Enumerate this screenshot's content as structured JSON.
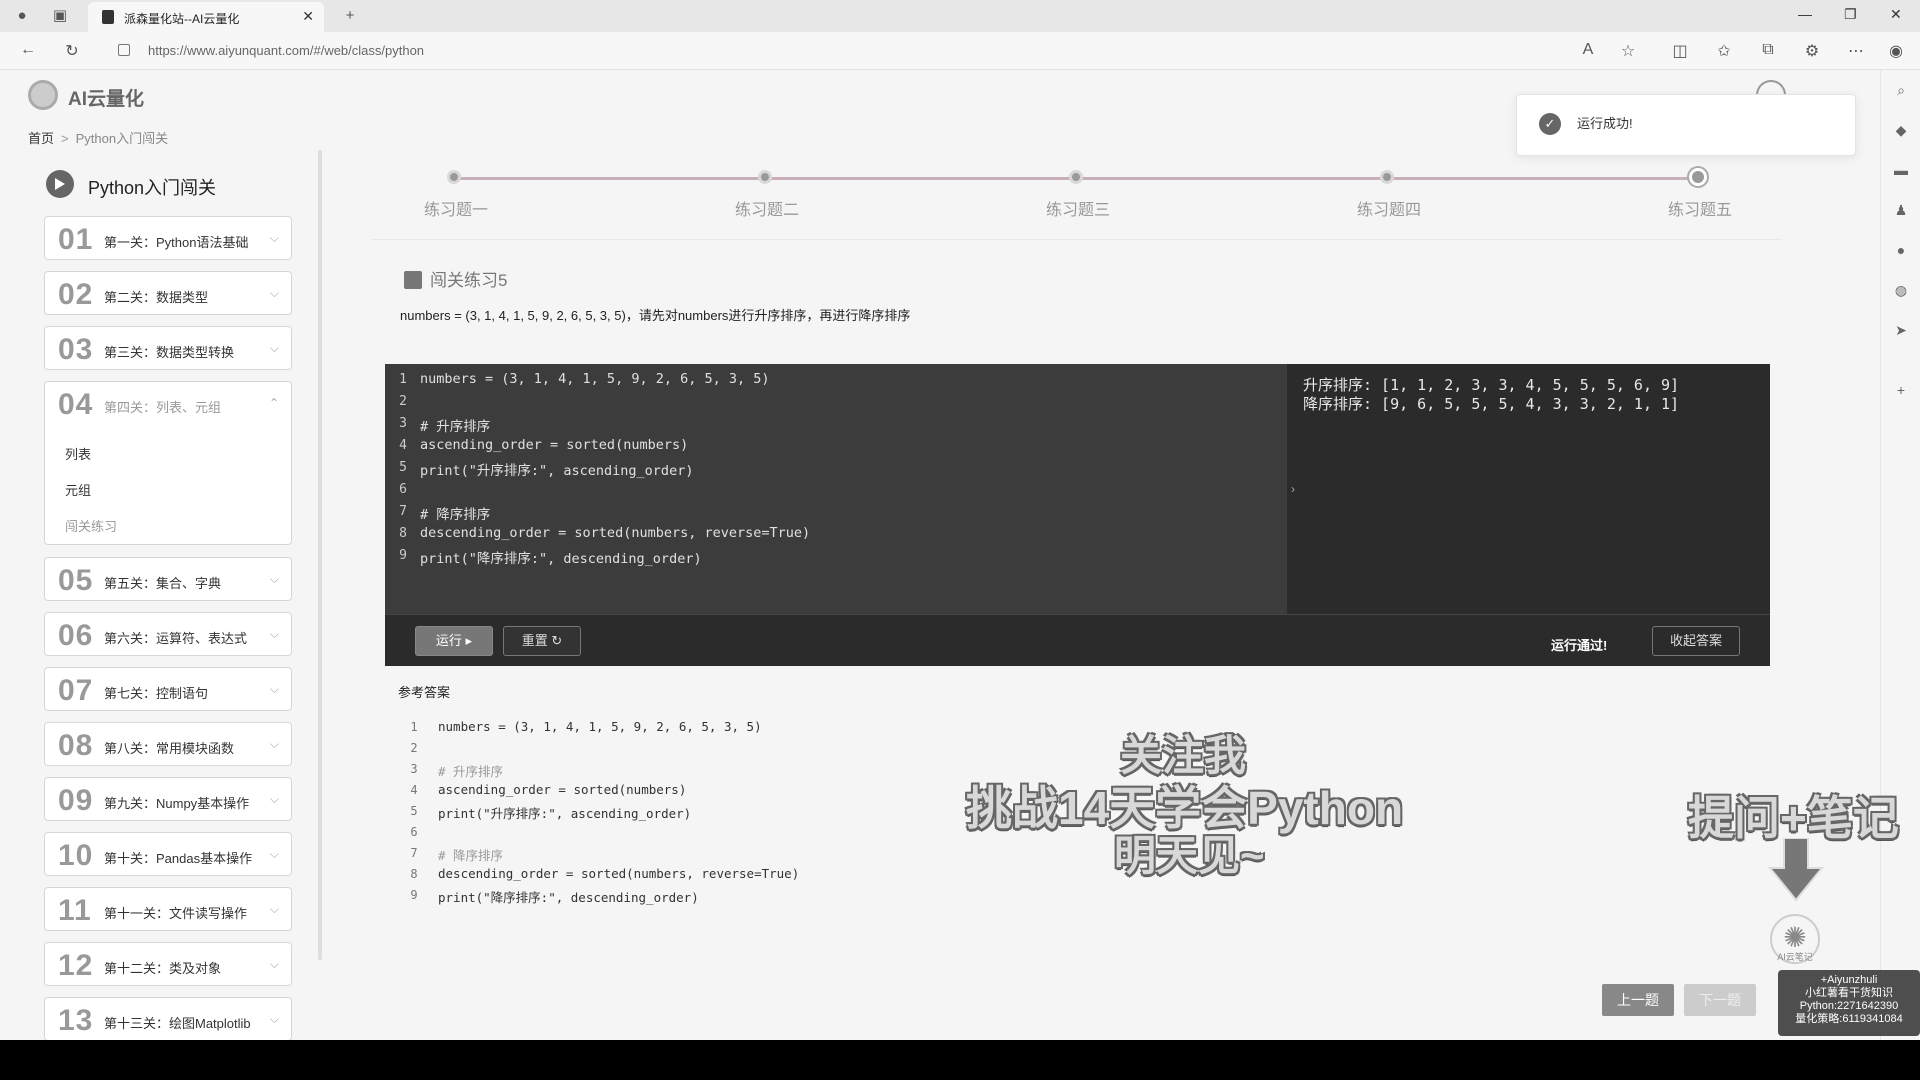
{
  "browser": {
    "tab_title": "派森量化站--AI云量化",
    "url": "https://www.aiyunquant.com/#/web/class/python"
  },
  "site": {
    "brand": "AI云量化",
    "breadcrumb": {
      "home": "首页",
      "current": "Python入门闯关"
    }
  },
  "sidebar": {
    "title": "Python入门闯关",
    "levels": [
      {
        "num": "01",
        "name": "第一关：Python语法基础",
        "chevron": "⌵"
      },
      {
        "num": "02",
        "name": "第二关：数据类型",
        "chevron": "⌵"
      },
      {
        "num": "03",
        "name": "第三关：数据类型转换",
        "chevron": "⌵"
      },
      {
        "num": "04",
        "name": "第四关：列表、元组",
        "chevron": "⌃"
      },
      {
        "num": "05",
        "name": "第五关：集合、字典",
        "chevron": "⌵"
      },
      {
        "num": "06",
        "name": "第六关：运算符、表达式",
        "chevron": "⌵"
      },
      {
        "num": "07",
        "name": "第七关：控制语句",
        "chevron": "⌵"
      },
      {
        "num": "08",
        "name": "第八关：常用模块函数",
        "chevron": "⌵"
      },
      {
        "num": "09",
        "name": "第九关：Numpy基本操作",
        "chevron": "⌵"
      },
      {
        "num": "10",
        "name": "第十关：Pandas基本操作",
        "chevron": "⌵"
      },
      {
        "num": "11",
        "name": "第十一关：文件读写操作",
        "chevron": "⌵"
      },
      {
        "num": "12",
        "name": "第十二关：类及对象",
        "chevron": "⌵"
      },
      {
        "num": "13",
        "name": "第十三关：绘图Matplotlib",
        "chevron": "⌵"
      }
    ],
    "level4_subitems": [
      "列表",
      "元组",
      "闯关练习"
    ]
  },
  "stepper": {
    "steps": [
      "练习题一",
      "练习题二",
      "练习题三",
      "练习题四",
      "练习题五"
    ],
    "current_step_index": 4
  },
  "toast": {
    "message": "运行成功!"
  },
  "exercise": {
    "title": "闯关练习5",
    "description": "numbers = (3, 1, 4, 1, 5, 9, 2, 6, 5, 3, 5)，请先对numbers进行升序排序，再进行降序排序"
  },
  "editor": {
    "lines": [
      "numbers = (3, 1, 4, 1, 5, 9, 2, 6, 5, 3, 5)",
      "",
      "# 升序排序",
      "ascending_order = sorted(numbers)",
      "print(\"升序排序:\", ascending_order)",
      "",
      "# 降序排序",
      "descending_order = sorted(numbers, reverse=True)",
      "print(\"降序排序:\", descending_order)"
    ],
    "output_lines": [
      "升序排序: [1, 1, 2, 3, 3, 4, 5, 5, 5, 6, 9]",
      "降序排序: [9, 6, 5, 5, 5, 4, 3, 3, 2, 1, 1]"
    ],
    "run_label": "运行",
    "reset_label": "重置",
    "pass_text": "运行通过!",
    "collapse_label": "收起答案"
  },
  "answer": {
    "label": "参考答案",
    "lines": [
      "numbers = (3, 1, 4, 1, 5, 9, 2, 6, 5, 3, 5)",
      "",
      "# 升序排序",
      "ascending_order = sorted(numbers)",
      "print(\"升序排序:\", ascending_order)",
      "",
      "# 降序排序",
      "descending_order = sorted(numbers, reverse=True)",
      "print(\"降序排序:\", descending_order)"
    ]
  },
  "pager": {
    "prev_label": "上一题",
    "next_label": "下一题"
  },
  "overlay": {
    "line1": "关注我",
    "line2": "挑战14天学会Python",
    "line3": "明天见~",
    "side": "提问+笔记",
    "ai_caption": "AI云笔记",
    "watermark": [
      "+Aiyunzhuli",
      "小红薯看干货知识",
      "Python:2271642390",
      "量化策略:6119341084"
    ]
  }
}
